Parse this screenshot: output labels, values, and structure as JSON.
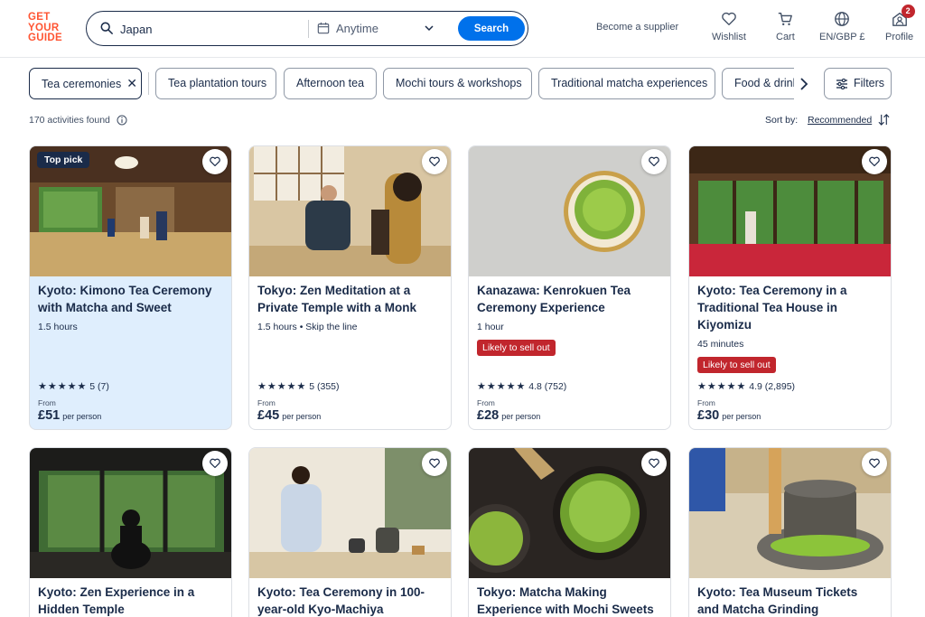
{
  "brand": {
    "line1": "GET",
    "line2": "YOUR",
    "line3": "GUIDE",
    "color": "#ff5533"
  },
  "search": {
    "value": "Japan",
    "date_label": "Anytime",
    "button_label": "Search"
  },
  "header_nav": {
    "supplier": "Become a supplier",
    "wishlist": "Wishlist",
    "cart": "Cart",
    "locale": "EN/GBP £",
    "profile": "Profile",
    "profile_badge": "2"
  },
  "chips": [
    {
      "label": "Tea ceremonies",
      "active": true
    },
    {
      "label": "Tea plantation tours"
    },
    {
      "label": "Afternoon tea"
    },
    {
      "label": "Mochi tours & workshops"
    },
    {
      "label": "Traditional matcha experiences"
    },
    {
      "label": "Food & drink"
    }
  ],
  "chip_remove": "✕",
  "filters_label": "Filters",
  "results": {
    "count_text": "170 activities found",
    "sort_by_label": "Sort by:",
    "sort_value": "Recommended"
  },
  "cards": [
    {
      "title": "Kyoto: Kimono Tea Ceremony with Matcha and Sweet",
      "badge": "Top pick",
      "meta": "1.5 hours",
      "stars": "★★★★★",
      "rating": "5",
      "reviews": "(7)",
      "from": "From",
      "price": "£51",
      "per": "per person"
    },
    {
      "title": "Tokyo: Zen Meditation at a Private Temple with a Monk",
      "meta": "1.5 hours • Skip the line",
      "stars": "★★★★★",
      "rating": "5",
      "reviews": "(355)",
      "from": "From",
      "price": "£45",
      "per": "per person"
    },
    {
      "title": "Kanazawa: Kenrokuen Tea Ceremony Experience",
      "meta": "1 hour",
      "sellout": "Likely to sell out",
      "stars": "★★★★★",
      "rating": "4.8",
      "reviews": "(752)",
      "from": "From",
      "price": "£28",
      "per": "per person"
    },
    {
      "title": "Kyoto: Tea Ceremony in a Traditional Tea House in Kiyomizu",
      "meta": "45 minutes",
      "sellout": "Likely to sell out",
      "stars": "★★★★★",
      "rating": "4.9",
      "reviews": "(2,895)",
      "from": "From",
      "price": "£30",
      "per": "per person"
    },
    {
      "title": "Kyoto: Zen Experience in a Hidden Temple"
    },
    {
      "title": "Kyoto: Tea Ceremony in 100-year-old Kyo-Machiya"
    },
    {
      "title": "Tokyo: Matcha Making Experience with Mochi Sweets"
    },
    {
      "title": "Kyoto: Tea Museum Tickets and Matcha Grinding Experience"
    }
  ]
}
